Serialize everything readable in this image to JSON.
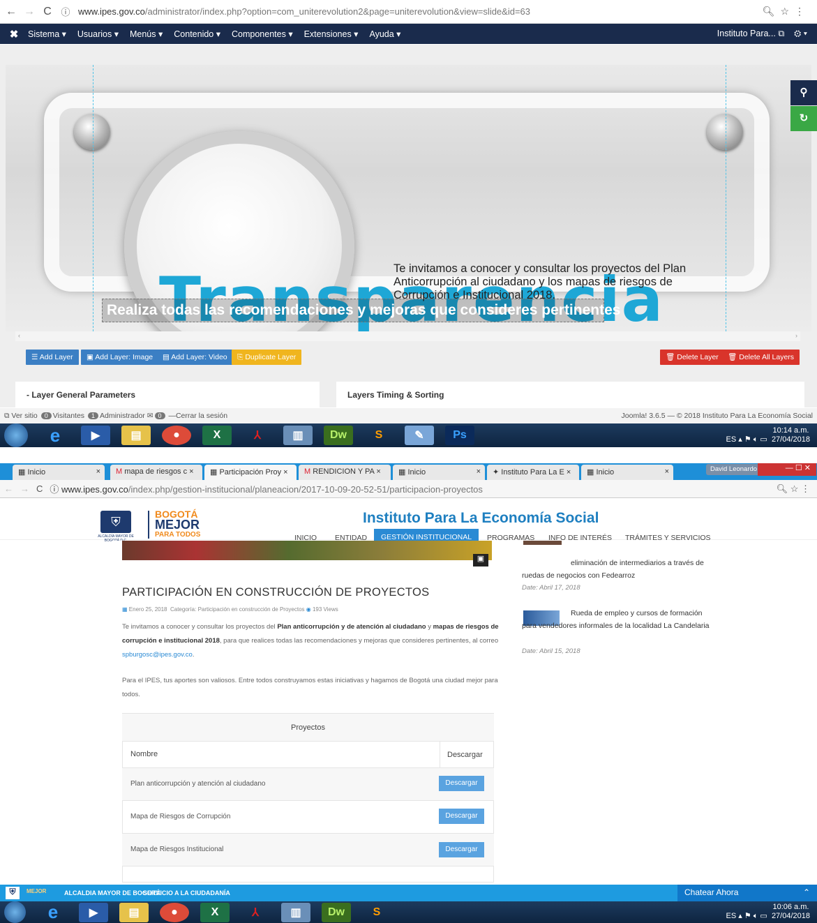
{
  "top": {
    "address_bar": {
      "url_host": "www.ipes.gov.co",
      "url_path": "/administrator/index.php?option=com_uniterevolution2&page=uniterevolution&view=slide&id=63"
    },
    "menu": [
      "Sistema",
      "Usuarios",
      "Menús",
      "Contenido",
      "Componentes",
      "Extensiones",
      "Ayuda"
    ],
    "site_link": "Instituto Para...",
    "slide": {
      "title": "Transparencia",
      "description": "Te invitamos a conocer y consultar los proyectos del Plan Anticorrupción al ciudadano y los mapas de riesgos de Corrupción e Institucional 2018.",
      "selected_layer": "Realiza todas las recomendaciones y mejoras que consideres pertinentes"
    },
    "toolbar": {
      "add_layer": "Add Layer",
      "add_image": "Add Layer: Image",
      "add_video": "Add Layer: Video",
      "duplicate": "Duplicate Layer",
      "delete": "Delete Layer",
      "delete_all": "Delete All Layers"
    },
    "panels": {
      "general": "Layer General Parameters",
      "timing": "Layers Timing & Sorting"
    },
    "status": {
      "ver_sitio": "Ver sitio",
      "visitantes_count": "0",
      "visitantes": "Visitantes",
      "admin_count": "1",
      "administrador": "Administrador",
      "msg_count": "0",
      "logout": "Cerrar la sesión",
      "version": "Joomla! 3.6.5 — © 2018 Instituto Para La Economía Social"
    },
    "tray": {
      "lang": "ES",
      "time": "10:14 a.m.",
      "date": "27/04/2018"
    }
  },
  "bottom": {
    "tabs": [
      "Inicio",
      "mapa de riesgos c",
      "Participación Proy",
      "RENDICION Y PA",
      "Inicio",
      "Instituto Para La E",
      "Inicio"
    ],
    "user": "David Leonardo",
    "address_bar": {
      "url_host": "www.ipes.gov.co",
      "url_path": "/index.php/gestion-institucional/planeacion/2017-10-09-20-52-51/participacion-proyectos"
    },
    "brand": {
      "bogota": "BOGOTÁ",
      "mejor": "MEJOR",
      "para_todos": "PARA TODOS",
      "alcaldia": "ALCALDÍA MAYOR DE BOGOTÁ D.C."
    },
    "site_title": "Instituto Para La Economía Social",
    "nav": [
      "INICIO",
      "ENTIDAD",
      "GESTIÓN INSTITUCIONAL",
      "PROGRAMAS",
      "INFO DE INTERÉS",
      "TRÁMITES Y SERVICIOS"
    ],
    "article": {
      "title": "PARTICIPACIÓN EN CONSTRUCCIÓN DE PROYECTOS",
      "date": "Enero 25, 2018",
      "category_label": "Categoría:",
      "category": "Participación en construcción de Proyectos",
      "views": "193 Views",
      "p1_a": "Te invitamos a conocer y consultar los proyectos del",
      "p1_b": "Plan anticorrupción y de atención al ciudadano",
      "p1_c": "y",
      "p1_d": "mapas de riesgos de corrupción e institucional 2018",
      "p1_e": ", para que realices todas las recomendaciones y mejoras que consideres pertinentes, al correo",
      "email": "spburgosc@ipes.gov.co",
      "p2": "Para el IPES, tus aportes son valiosos. Entre todos construyamos estas iniciativas y hagamos de Bogotá una ciudad mejor para todos."
    },
    "table": {
      "caption": "Proyectos",
      "headers": [
        "Nombre",
        "Descargar"
      ],
      "rows": [
        {
          "name": "Plan anticorrupción y atención al ciudadano",
          "action": "Descargar"
        },
        {
          "name": "Mapa de Riesgos de Corrupción",
          "action": "Descargar"
        },
        {
          "name": "Mapa de Riesgos Institucional",
          "action": "Descargar"
        }
      ]
    },
    "sidebar": {
      "news1_text": "eliminación de intermediarios a través de ruedas de negocios con Fedearroz",
      "news1_date": "Date: Abril 17, 2018",
      "news2_text": "Rueda de empleo y cursos de formación para vendedores informales de la localidad La Candelaria",
      "news2_date": "Date: Abril 15, 2018"
    },
    "footer": {
      "alcaldia": "ALCALDIA MAYOR DE BOGOTÁ",
      "servicio": "SERVICIO A LA CIUDADANÍA",
      "chat": "Chatear Ahora"
    },
    "tray": {
      "lang": "ES",
      "time": "10:06 a.m.",
      "date": "27/04/2018"
    }
  }
}
